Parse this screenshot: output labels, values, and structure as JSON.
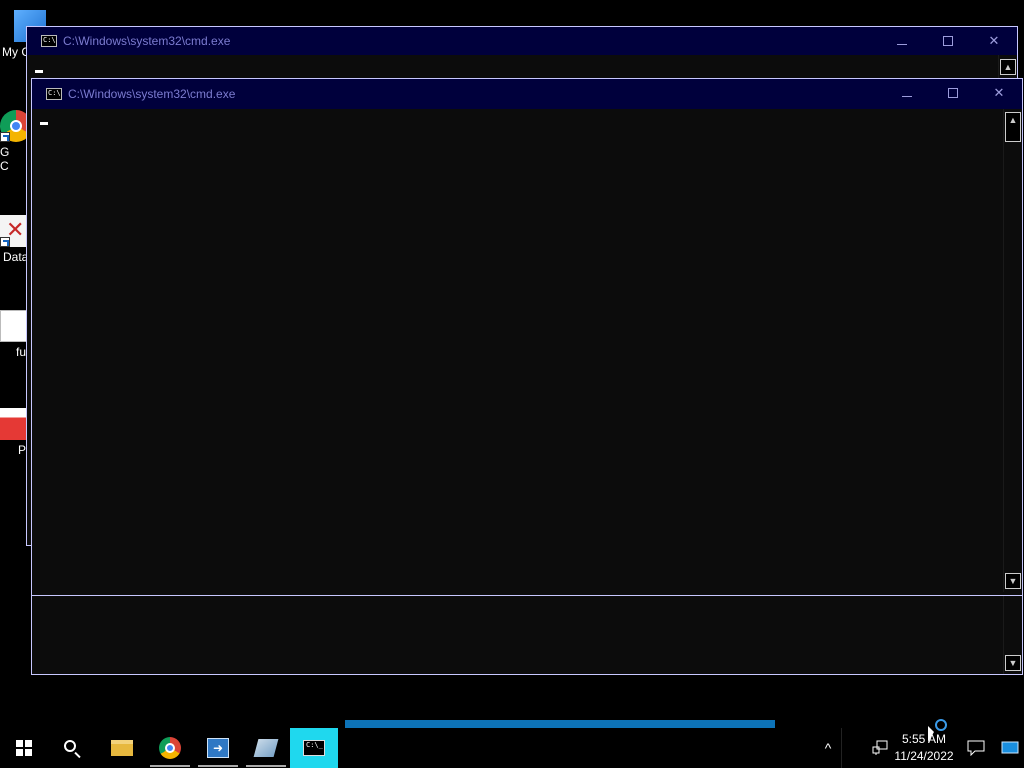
{
  "desktop": {
    "icons": [
      {
        "label": "My C",
        "icon": "computer-icon"
      },
      {
        "label": "G\nC",
        "icon": "chrome-icon"
      },
      {
        "label": "Data",
        "icon": "database-icon"
      },
      {
        "label": "fu",
        "icon": "file-icon"
      },
      {
        "label": "P",
        "icon": "pdf-icon"
      }
    ]
  },
  "windows": [
    {
      "title": "C:\\Windows\\system32\\cmd.exe",
      "icon_text": "C:\\"
    },
    {
      "title": "C:\\Windows\\system32\\cmd.exe",
      "icon_text": "C:\\"
    }
  ],
  "window_buttons": {
    "minimize": "",
    "maximize": "",
    "close": "✕"
  },
  "scrollbar": {
    "up": "▲",
    "down": "▼"
  },
  "taskbar": {
    "items": [
      {
        "name": "start",
        "icon": "windows-logo-icon"
      },
      {
        "name": "search",
        "icon": "search-icon"
      },
      {
        "name": "file-explorer",
        "icon": "folder-icon"
      },
      {
        "name": "chrome",
        "icon": "chrome-icon"
      },
      {
        "name": "remote-desktop",
        "icon": "remote-desktop-icon"
      },
      {
        "name": "notepad",
        "icon": "notepad-icon"
      },
      {
        "name": "cmd",
        "icon": "cmd-icon",
        "active": true
      }
    ],
    "tray": {
      "show_hidden": "^",
      "time": "5:55 AM",
      "date": "11/24/2022"
    }
  },
  "colors": {
    "titlebar": "#00003c",
    "console_bg": "#0c0c0c",
    "active_taskbar": "#1fd8ee",
    "progress": "#0d73b8"
  }
}
